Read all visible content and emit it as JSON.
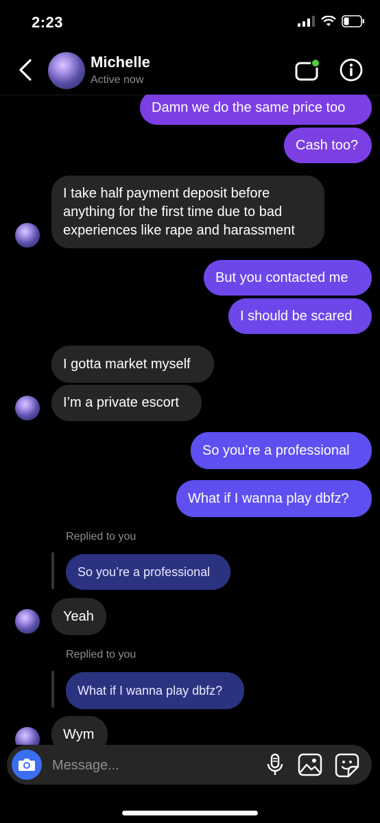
{
  "status_bar": {
    "time": "2:23"
  },
  "header": {
    "contact_name": "Michelle",
    "status": "Active now"
  },
  "messages": [
    {
      "side": "outgoing",
      "text": "Damn we do the same price too"
    },
    {
      "side": "outgoing",
      "text": "Cash too?"
    },
    {
      "side": "incoming",
      "text": "I take half payment deposit before anything for the first time due to bad experiences like rape and harassment"
    },
    {
      "side": "outgoing",
      "text": "But you contacted me"
    },
    {
      "side": "outgoing",
      "text": "I should be scared"
    },
    {
      "side": "incoming",
      "text": "I gotta market myself"
    },
    {
      "side": "incoming",
      "text": "I’m a private escort"
    },
    {
      "side": "outgoing",
      "text": "So you’re a professional"
    },
    {
      "side": "outgoing",
      "text": "What if I wanna play dbfz?"
    },
    {
      "side": "incoming",
      "replied_label": "Replied to you",
      "quoted": "So you’re a professional",
      "text": "Yeah"
    },
    {
      "side": "incoming",
      "replied_label": "Replied to you",
      "quoted": "What if I wanna play dbfz?",
      "text": "Wym"
    }
  ],
  "composer": {
    "placeholder": "Message..."
  },
  "icons": {
    "back": "chevron-left-icon",
    "video": "video-call-icon",
    "info": "info-icon",
    "camera": "camera-icon",
    "mic": "microphone-icon",
    "gallery": "gallery-icon",
    "sticker": "sticker-icon"
  },
  "colors": {
    "background": "#000000",
    "incoming_bubble": "#262626",
    "outgoing_bubble": "#7b3fe4",
    "quoted_bubble": "#2b3380",
    "online_dot": "#4cd137",
    "camera_button": "#3c6ef2"
  }
}
